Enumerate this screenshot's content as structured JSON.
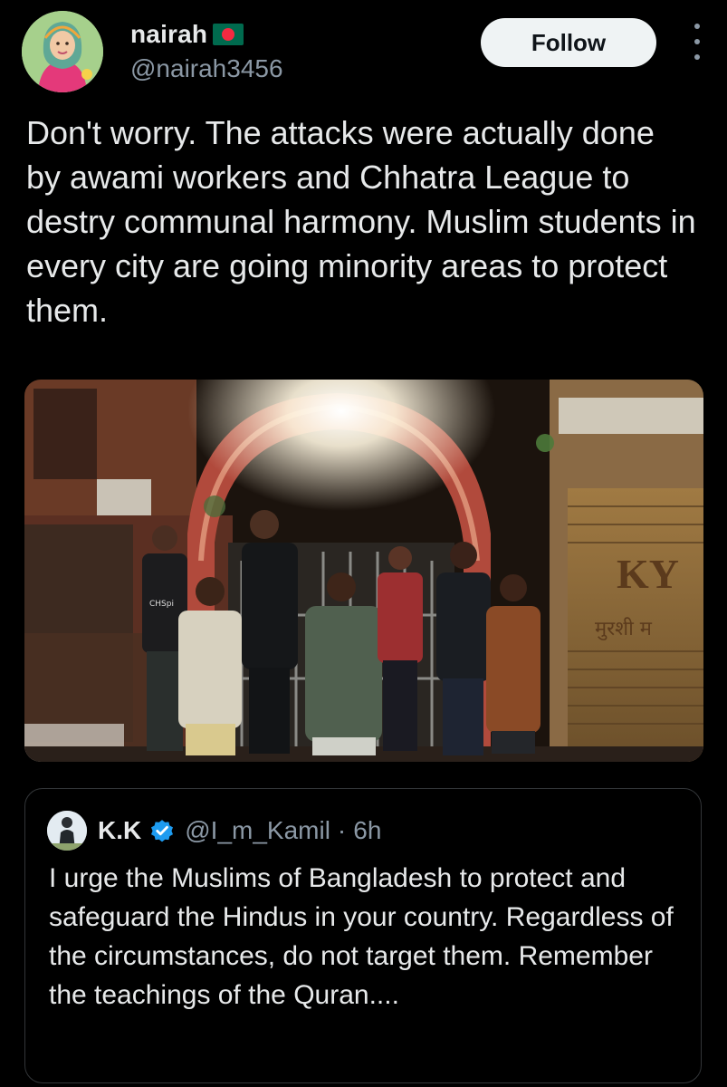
{
  "author": {
    "display_name": "nairah",
    "handle": "@nairah3456",
    "flag_icon": "bangladesh-flag-icon"
  },
  "actions": {
    "follow_label": "Follow"
  },
  "tweet": {
    "text": "Don't worry. The attacks were actually done by awami workers and Chhatra League to destry communal harmony. Muslim students in every city are going minority areas to protect them."
  },
  "media": {
    "sign_letters": "KY",
    "sign_script": "मुरशी म",
    "shirt_text": "CHSpi"
  },
  "quoted_tweet": {
    "display_name": "K.K",
    "handle": "@I_m_Kamil",
    "separator": "·",
    "time": "6h",
    "text": "I urge the Muslims of Bangladesh to protect and safeguard the Hindus in your country. Regardless of the circumstances, do not target them. Remember the teachings of the Quran...."
  },
  "colors": {
    "background": "#000000",
    "text_primary": "#e7e9ea",
    "text_secondary": "#8b98a5",
    "follow_button_bg": "#eff3f4",
    "verified_blue": "#1d9bf0",
    "border": "#333639"
  }
}
